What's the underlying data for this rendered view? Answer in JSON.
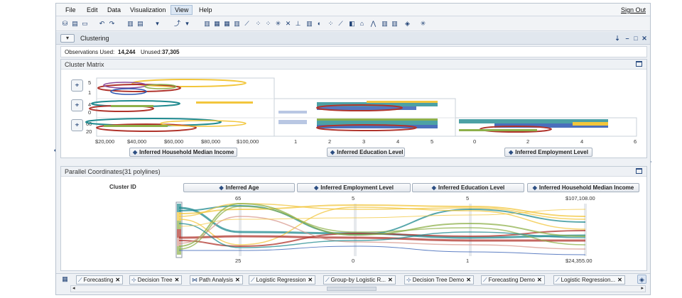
{
  "menu": {
    "items": [
      "File",
      "Edit",
      "Data",
      "Visualization",
      "View",
      "Help"
    ],
    "active": "View",
    "signout": "Sign Out"
  },
  "window": {
    "title": "Clustering",
    "obs_used_label": "Observations Used:",
    "obs_used": "14,244",
    "unused_label": "Unused:",
    "unused": "37,305"
  },
  "cluster_matrix": {
    "title": "Cluster Matrix",
    "income_ticks": [
      "$20,000",
      "$40,000",
      "$60,000",
      "$80,000",
      "$100,000"
    ],
    "education_ticks": [
      "1",
      "2",
      "3",
      "4",
      "5"
    ],
    "employment_ticks": [
      "0",
      "2",
      "4",
      "6"
    ],
    "row_ticks": [
      [
        "5",
        "1"
      ],
      [
        "4",
        "0"
      ],
      [
        "60",
        "20"
      ]
    ],
    "axis_income": "Inferred Household Median Income",
    "axis_education": "Inferred Education Level",
    "axis_employment": "Inferred Employment Level"
  },
  "parallel": {
    "title": "Parallel Coordinates(31 polylines)",
    "cluster_label": "Cluster ID",
    "axes": [
      "Inferred Age",
      "Inferred Employment Level",
      "Inferred Education Level",
      "Inferred Household Median Income"
    ],
    "top_values": [
      "65",
      "5",
      "5",
      "$107,108.00"
    ],
    "bottom_values": [
      "25",
      "0",
      "1",
      "$24,355.00"
    ]
  },
  "tabs": [
    "Forecasting",
    "Decision Tree",
    "Path Analysis",
    "Logistic Regression",
    "Group-by Logistic R...",
    "Decision Tree Demo",
    "Forecasting Demo",
    "Logistic Regression..."
  ],
  "colors": {
    "teal": "#1f8a8f",
    "yellow": "#f2c63c",
    "red": "#b0342c",
    "green": "#8db04a",
    "blue": "#2a56b0",
    "purple": "#8b4a9a"
  }
}
